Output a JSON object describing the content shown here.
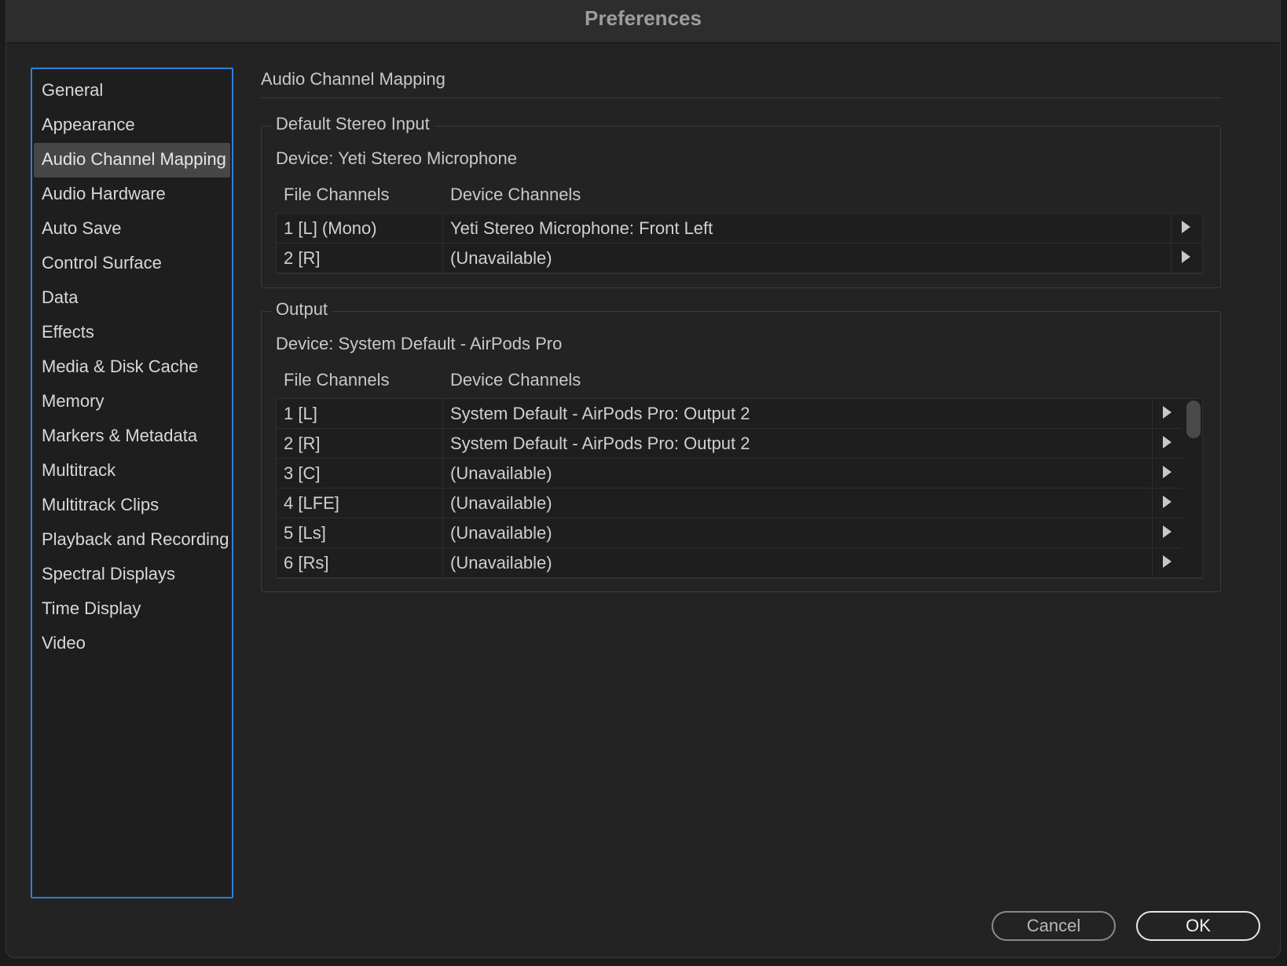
{
  "window": {
    "title": "Preferences"
  },
  "sidebar": {
    "items": [
      {
        "label": "General",
        "active": false
      },
      {
        "label": "Appearance",
        "active": false
      },
      {
        "label": "Audio Channel Mapping",
        "active": true
      },
      {
        "label": "Audio Hardware",
        "active": false
      },
      {
        "label": "Auto Save",
        "active": false
      },
      {
        "label": "Control Surface",
        "active": false
      },
      {
        "label": "Data",
        "active": false
      },
      {
        "label": "Effects",
        "active": false
      },
      {
        "label": "Media & Disk Cache",
        "active": false
      },
      {
        "label": "Memory",
        "active": false
      },
      {
        "label": "Markers & Metadata",
        "active": false
      },
      {
        "label": "Multitrack",
        "active": false
      },
      {
        "label": "Multitrack Clips",
        "active": false
      },
      {
        "label": "Playback and Recording",
        "active": false
      },
      {
        "label": "Spectral Displays",
        "active": false
      },
      {
        "label": "Time Display",
        "active": false
      },
      {
        "label": "Video",
        "active": false
      }
    ]
  },
  "main": {
    "title": "Audio Channel Mapping",
    "input": {
      "legend": "Default Stereo Input",
      "device": "Device: Yeti Stereo Microphone",
      "col_file": "File Channels",
      "col_device": "Device Channels",
      "rows": [
        {
          "file": "1 [L] (Mono)",
          "device": "Yeti Stereo Microphone: Front Left"
        },
        {
          "file": "2 [R]",
          "device": "(Unavailable)"
        }
      ]
    },
    "output": {
      "legend": "Output",
      "device": "Device: System Default - AirPods Pro",
      "col_file": "File Channels",
      "col_device": "Device Channels",
      "rows": [
        {
          "file": "1 [L]",
          "device": "System Default - AirPods Pro: Output 2"
        },
        {
          "file": "2 [R]",
          "device": "System Default - AirPods Pro: Output 2"
        },
        {
          "file": "3 [C]",
          "device": "(Unavailable)"
        },
        {
          "file": "4 [LFE]",
          "device": "(Unavailable)"
        },
        {
          "file": "5 [Ls]",
          "device": "(Unavailable)"
        },
        {
          "file": "6 [Rs]",
          "device": "(Unavailable)"
        }
      ]
    }
  },
  "buttons": {
    "cancel": "Cancel",
    "ok": "OK"
  },
  "colors": {
    "accent": "#2f7fd8",
    "selection": "#474747",
    "background": "#232323"
  }
}
